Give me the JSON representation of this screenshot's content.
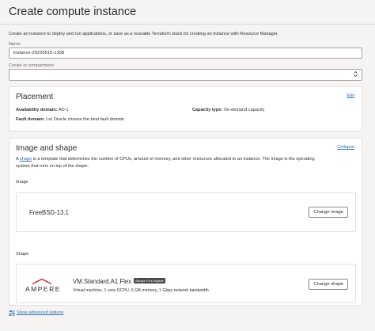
{
  "page": {
    "title": "Create compute instance",
    "intro": "Create an instance to deploy and run applications, or save as a reusable Terraform stack for creating an instance with Resource Manager."
  },
  "form": {
    "name_label": "Name",
    "name_value": "instance-20220515-1358",
    "compartment_label": "Create in compartment",
    "compartment_value": ""
  },
  "placement": {
    "title": "Placement",
    "edit_label": "Edit",
    "availability_domain_label": "Availability domain:",
    "availability_domain_value": "AD-1",
    "capacity_type_label": "Capacity type:",
    "capacity_type_value": "On-demand capacity",
    "fault_domain_label": "Fault domain:",
    "fault_domain_value": "Let Oracle choose the best fault domain"
  },
  "image_shape": {
    "title": "Image and shape",
    "collapse_label": "Collapse",
    "desc_prefix": "A",
    "desc_link": "shape",
    "desc_line1": "is a template that determines the number of CPUs, amount of memory, and other resources allocated to an instance. The image is the operating",
    "desc_line2": "system that runs on top of the shape.",
    "image_label": "Image",
    "image_name": "FreeBSD-13.1",
    "change_image_label": "Change image",
    "shape_label": "Shape",
    "shape_logo_text": "AMPERE",
    "shape_name": "VM.Standard.A1.Flex",
    "shape_badge": "Always Free-eligible",
    "shape_desc": "Virtual machine, 1 core OCPU, 6 GB memory, 1 Gbps network bandwidth",
    "change_shape_label": "Change shape"
  },
  "advanced": {
    "label": "Show advanced options"
  },
  "colors": {
    "link": "#2b6fb6",
    "ampere_red": "#d1232a",
    "badge_bg": "#4b4845"
  }
}
